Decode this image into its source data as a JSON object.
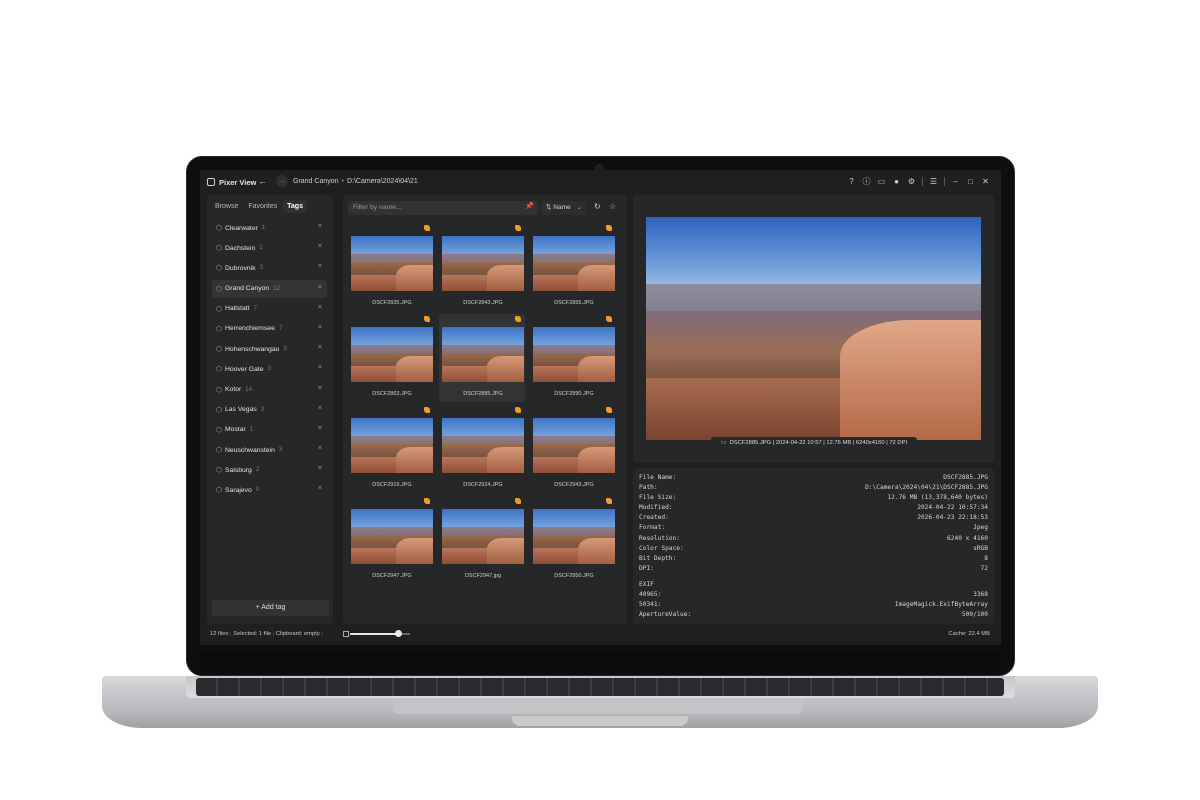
{
  "app": {
    "name": "Pixer View",
    "breadcrumb": [
      "Grand Canyon",
      "D:\\Camera\\2024\\04\\21"
    ]
  },
  "title_icons": [
    "help-icon",
    "info-icon",
    "monitor-icon",
    "circle-icon",
    "gear-icon",
    "menu-icon",
    "minimize-icon",
    "maximize-icon",
    "close-icon"
  ],
  "sidebar": {
    "tabs": [
      {
        "label": "Browse",
        "active": false
      },
      {
        "label": "Favorites",
        "active": false
      },
      {
        "label": "Tags",
        "active": true
      }
    ],
    "tags": [
      {
        "name": "Clearwater",
        "count": "1"
      },
      {
        "name": "Dachstein",
        "count": "1"
      },
      {
        "name": "Dubrovnik",
        "count": "3"
      },
      {
        "name": "Grand Canyon",
        "count": "12",
        "active": true
      },
      {
        "name": "Hallstatt",
        "count": "7"
      },
      {
        "name": "Herrenchiemsee",
        "count": "7"
      },
      {
        "name": "Hohenschwangau",
        "count": "3"
      },
      {
        "name": "Hoover Gate",
        "count": "3"
      },
      {
        "name": "Kotor",
        "count": "14"
      },
      {
        "name": "Las Vegas",
        "count": "3"
      },
      {
        "name": "Mostar",
        "count": "1"
      },
      {
        "name": "Neuschwanstein",
        "count": "3"
      },
      {
        "name": "Salsburg",
        "count": "2"
      },
      {
        "name": "Sarajevo",
        "count": "0"
      }
    ],
    "add_tag_label": "+ Add tag"
  },
  "browser": {
    "filter_placeholder": "Filter by name...",
    "sort_label": "Name",
    "files": [
      {
        "name": "DSCF2835.JPG"
      },
      {
        "name": "DSCF2843.JPG"
      },
      {
        "name": "DSCF2855.JPG"
      },
      {
        "name": "DSCF2863.JPG"
      },
      {
        "name": "DSCF2885.JPG",
        "selected": true
      },
      {
        "name": "DSCF2890.JPG"
      },
      {
        "name": "DSCF2919.JPG"
      },
      {
        "name": "DSCF2924.JPG"
      },
      {
        "name": "DSCF2943.JPG"
      },
      {
        "name": "DSCF2947.JPG"
      },
      {
        "name": "DSCF2947.jpg"
      },
      {
        "name": "DSCF2950.JPG"
      }
    ]
  },
  "preview": {
    "caption": "DSCF2885.JPG | 2024-04-22 10:57 | 12.76 MB | 6240x4160 | 72 DPI"
  },
  "metadata": {
    "rows": [
      {
        "key": "File Name:",
        "value": "DSCF2885.JPG"
      },
      {
        "key": "Path:",
        "value": "D:\\Camera\\2024\\04\\21\\DSCF2885.JPG"
      },
      {
        "key": "File Size:",
        "value": "12.76 MB (13,378,640 bytes)"
      },
      {
        "key": "Modified:",
        "value": "2024-04-22 10:57:34"
      },
      {
        "key": "Created:",
        "value": "2026-04-23 22:18:53"
      },
      {
        "key": "Format:",
        "value": "Jpeg"
      },
      {
        "key": "Resolution:",
        "value": "6240 x 4160"
      },
      {
        "key": "Color Space:",
        "value": "sRGB"
      },
      {
        "key": "Bit Depth:",
        "value": "8"
      },
      {
        "key": "DPI:",
        "value": "72"
      }
    ],
    "exif_heading": "EXIF",
    "exif_rows": [
      {
        "key": "40965:",
        "value": "3368"
      },
      {
        "key": "50341:",
        "value": "ImageMagick.ExifByteArray"
      },
      {
        "key": "ApertureValue:",
        "value": "500/100"
      }
    ]
  },
  "status": {
    "files": "12 files",
    "selected": "Selected: 1 file",
    "clipboard": "Clipboard: empty",
    "zoom_fraction": 0.8,
    "cache": "Cache: 22.4 MB"
  },
  "colors": {
    "accent_flag": "#f29c22",
    "pin": "#e05a4a"
  }
}
